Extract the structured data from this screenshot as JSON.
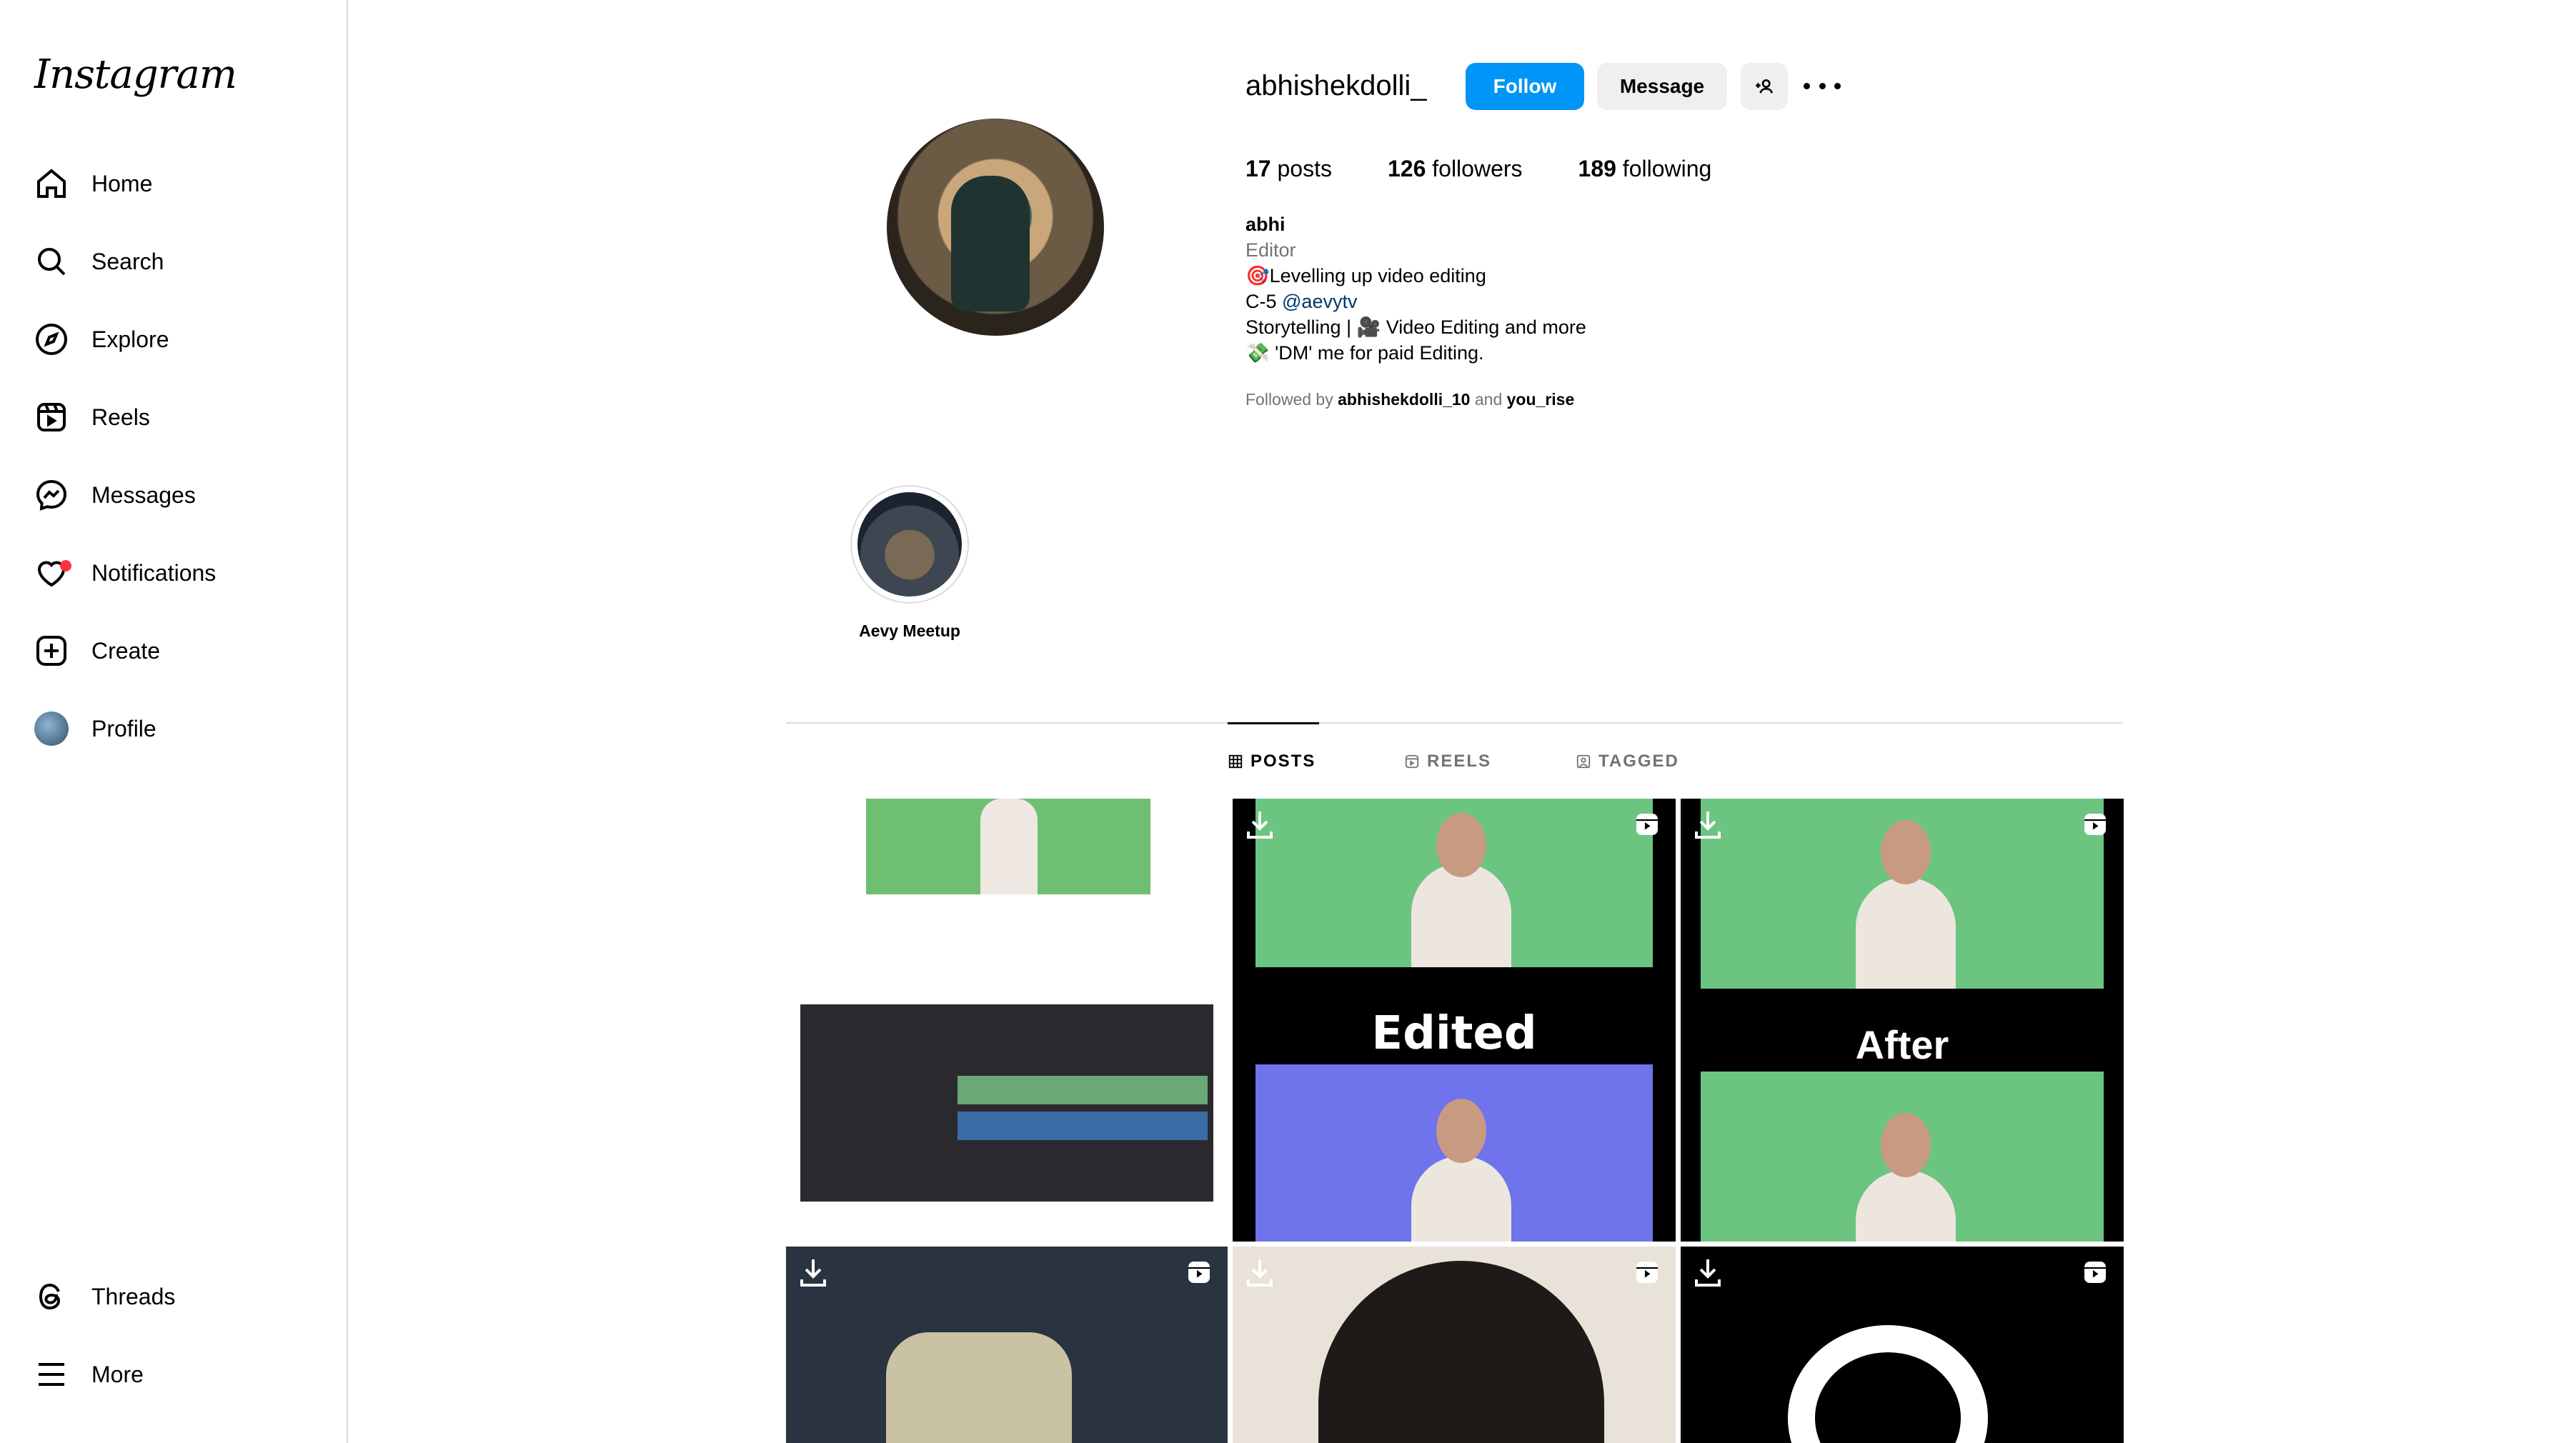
{
  "app": {
    "logo": "Instagram"
  },
  "sidebar": {
    "items": [
      {
        "label": "Home",
        "icon": "home-icon"
      },
      {
        "label": "Search",
        "icon": "search-icon"
      },
      {
        "label": "Explore",
        "icon": "compass-icon"
      },
      {
        "label": "Reels",
        "icon": "reels-icon"
      },
      {
        "label": "Messages",
        "icon": "messenger-icon"
      },
      {
        "label": "Notifications",
        "icon": "heart-icon"
      },
      {
        "label": "Create",
        "icon": "plus-square-icon"
      },
      {
        "label": "Profile",
        "icon": "avatar"
      }
    ],
    "bottom": [
      {
        "label": "Threads",
        "icon": "threads-icon"
      },
      {
        "label": "More",
        "icon": "hamburger-icon"
      }
    ]
  },
  "profile": {
    "username": "abhishekdolli_",
    "follow_label": "Follow",
    "message_label": "Message",
    "stats": {
      "posts_count": "17",
      "posts_label": "posts",
      "followers_count": "126",
      "followers_label": "followers",
      "following_count": "189",
      "following_label": "following"
    },
    "bio": {
      "name": "abhi",
      "category": "Editor",
      "line1": "🎯Levelling up video editing",
      "line2_prefix": "C-5 ",
      "line2_link": "@aevytv",
      "line3": "Storytelling | 🎥 Video Editing and more",
      "line4": "💸 'DM' me for paid Editing."
    },
    "followed_by": {
      "prefix": "Followed by ",
      "user1": "abhishekdolli_10",
      "joiner": " and ",
      "user2": "you_rise"
    }
  },
  "highlights": [
    {
      "label": "Aevy Meetup"
    }
  ],
  "tabs": [
    {
      "label": "POSTS",
      "active": true
    },
    {
      "label": "REELS",
      "active": false
    },
    {
      "label": "TAGGED",
      "active": false
    }
  ],
  "posts": {
    "p2_caption": "Edited",
    "p3_caption": "After"
  },
  "colors": {
    "accent": "#0095f6",
    "notification_dot": "#ff3040",
    "link": "#00376b"
  }
}
